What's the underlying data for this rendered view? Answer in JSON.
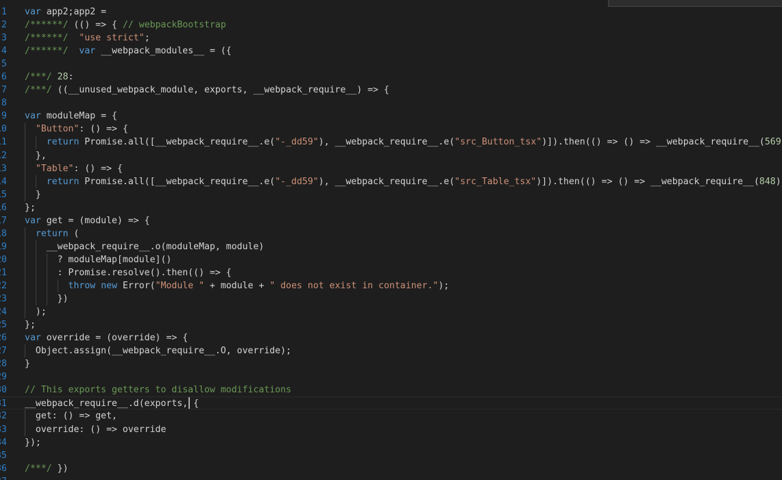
{
  "editor": {
    "language": "javascript",
    "current_line": 31,
    "lines": [
      {
        "n": "1",
        "segments": [
          {
            "t": "var",
            "c": "kw"
          },
          {
            "t": " app2;app2 ="
          }
        ]
      },
      {
        "n": "2",
        "segments": [
          {
            "t": "/******/",
            "c": "cm"
          },
          {
            "t": " (() => { "
          },
          {
            "t": "// webpackBootstrap",
            "c": "cm"
          }
        ]
      },
      {
        "n": "3",
        "segments": [
          {
            "t": "/******/",
            "c": "cm"
          },
          {
            "t": "  "
          },
          {
            "t": "\"use strict\"",
            "c": "str"
          },
          {
            "t": ";"
          }
        ]
      },
      {
        "n": "4",
        "segments": [
          {
            "t": "/******/",
            "c": "cm"
          },
          {
            "t": "  "
          },
          {
            "t": "var",
            "c": "kw"
          },
          {
            "t": " __webpack_modules__ = ({"
          }
        ]
      },
      {
        "n": "5",
        "segments": []
      },
      {
        "n": "6",
        "segments": [
          {
            "t": "/***/",
            "c": "cm"
          },
          {
            "t": " "
          },
          {
            "t": "28",
            "c": "num"
          },
          {
            "t": ":"
          }
        ]
      },
      {
        "n": "7",
        "segments": [
          {
            "t": "/***/",
            "c": "cm"
          },
          {
            "t": " ((__unused_webpack_module, exports, __webpack_require__) => {"
          }
        ]
      },
      {
        "n": "8",
        "segments": []
      },
      {
        "n": "9",
        "segments": [
          {
            "t": "var",
            "c": "kw"
          },
          {
            "t": " moduleMap = {"
          }
        ]
      },
      {
        "n": "10",
        "segments": [
          {
            "t": "  "
          },
          {
            "t": "\"Button\"",
            "c": "str"
          },
          {
            "t": ": () => {"
          }
        ]
      },
      {
        "n": "11",
        "segments": [
          {
            "t": "    "
          },
          {
            "t": "return",
            "c": "kw"
          },
          {
            "t": " Promise.all([__webpack_require__.e("
          },
          {
            "t": "\"-_dd59\"",
            "c": "str"
          },
          {
            "t": "), __webpack_require__.e("
          },
          {
            "t": "\"src_Button_tsx\"",
            "c": "str"
          },
          {
            "t": ")]).then(() => () => __webpack_require__("
          },
          {
            "t": "569",
            "c": "num"
          },
          {
            "t": "));"
          }
        ]
      },
      {
        "n": "12",
        "segments": [
          {
            "t": "  },"
          }
        ]
      },
      {
        "n": "13",
        "segments": [
          {
            "t": "  "
          },
          {
            "t": "\"Table\"",
            "c": "str"
          },
          {
            "t": ": () => {"
          }
        ]
      },
      {
        "n": "14",
        "segments": [
          {
            "t": "    "
          },
          {
            "t": "return",
            "c": "kw"
          },
          {
            "t": " Promise.all([__webpack_require__.e("
          },
          {
            "t": "\"-_dd59\"",
            "c": "str"
          },
          {
            "t": "), __webpack_require__.e("
          },
          {
            "t": "\"src_Table_tsx\"",
            "c": "str"
          },
          {
            "t": ")]).then(() => () => __webpack_require__("
          },
          {
            "t": "848",
            "c": "num"
          },
          {
            "t": "));"
          }
        ]
      },
      {
        "n": "15",
        "segments": [
          {
            "t": "  }"
          }
        ]
      },
      {
        "n": "16",
        "segments": [
          {
            "t": "};"
          }
        ]
      },
      {
        "n": "17",
        "segments": [
          {
            "t": "var",
            "c": "kw"
          },
          {
            "t": " get = (module) => {"
          }
        ]
      },
      {
        "n": "18",
        "segments": [
          {
            "t": "  "
          },
          {
            "t": "return",
            "c": "kw"
          },
          {
            "t": " ("
          }
        ]
      },
      {
        "n": "19",
        "segments": [
          {
            "t": "    __webpack_require__.o(moduleMap, module)"
          }
        ]
      },
      {
        "n": "20",
        "segments": [
          {
            "t": "      ? moduleMap[module]()"
          }
        ]
      },
      {
        "n": "21",
        "segments": [
          {
            "t": "      : Promise.resolve().then(() => {"
          }
        ]
      },
      {
        "n": "22",
        "segments": [
          {
            "t": "        "
          },
          {
            "t": "throw",
            "c": "kw"
          },
          {
            "t": " "
          },
          {
            "t": "new",
            "c": "kw"
          },
          {
            "t": " Error("
          },
          {
            "t": "\"Module \"",
            "c": "str"
          },
          {
            "t": " + module + "
          },
          {
            "t": "\" does not exist in container.\"",
            "c": "str"
          },
          {
            "t": ");"
          }
        ]
      },
      {
        "n": "23",
        "segments": [
          {
            "t": "      })"
          }
        ]
      },
      {
        "n": "24",
        "segments": [
          {
            "t": "  );"
          }
        ]
      },
      {
        "n": "25",
        "segments": [
          {
            "t": "};"
          }
        ]
      },
      {
        "n": "26",
        "segments": [
          {
            "t": "var",
            "c": "kw"
          },
          {
            "t": " override = (override) => {"
          }
        ]
      },
      {
        "n": "27",
        "segments": [
          {
            "t": "  Object.assign(__webpack_require__.O, override);"
          }
        ]
      },
      {
        "n": "28",
        "segments": [
          {
            "t": "}"
          }
        ]
      },
      {
        "n": "29",
        "segments": []
      },
      {
        "n": "30",
        "segments": [
          {
            "t": "// This exports getters to disallow modifications",
            "c": "cm"
          }
        ]
      },
      {
        "n": "31",
        "segments": [
          {
            "t": "__webpack_require__.d(exports, {"
          }
        ]
      },
      {
        "n": "32",
        "segments": [
          {
            "t": "  get: () => get,"
          }
        ]
      },
      {
        "n": "33",
        "segments": [
          {
            "t": "  override: () => override"
          }
        ]
      },
      {
        "n": "34",
        "segments": [
          {
            "t": "});"
          }
        ]
      },
      {
        "n": "35",
        "segments": []
      },
      {
        "n": "36",
        "segments": [
          {
            "t": "/***/",
            "c": "cm"
          },
          {
            "t": " })"
          }
        ]
      },
      {
        "n": "37",
        "segments": []
      }
    ]
  }
}
